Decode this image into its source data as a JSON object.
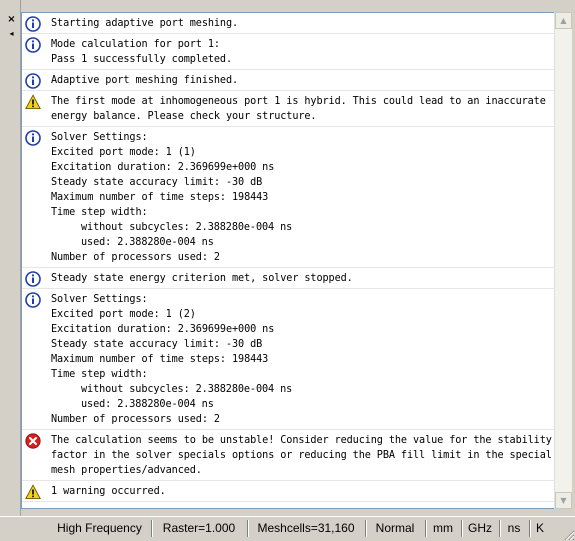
{
  "left_strip": {
    "close_glyph": "×",
    "pin_glyph": "◂"
  },
  "messages": [
    {
      "type": "info",
      "icon": "info-icon",
      "lines": [
        {
          "text": "Starting adaptive port meshing."
        }
      ]
    },
    {
      "type": "info",
      "icon": "info-icon",
      "lines": [
        {
          "text": "Mode calculation for port 1:"
        },
        {
          "text": "Pass 1 successfully completed."
        }
      ]
    },
    {
      "type": "info",
      "icon": "info-icon",
      "lines": [
        {
          "text": "Adaptive port meshing finished."
        }
      ]
    },
    {
      "type": "warning",
      "icon": "warning-icon",
      "lines": [
        {
          "text": "The first mode at inhomogeneous port 1 is hybrid. This could lead to an inaccurate"
        },
        {
          "text": "energy balance. Please check your structure."
        }
      ]
    },
    {
      "type": "info",
      "icon": "info-icon",
      "lines": [
        {
          "text": "Solver Settings:"
        },
        {
          "text": "Excited port mode: 1 (1)"
        },
        {
          "text": "Excitation duration: 2.369699e+000 ns"
        },
        {
          "text": "Steady state accuracy limit: -30 dB"
        },
        {
          "text": "Maximum number of time steps: 198443"
        },
        {
          "text": "Time step width:"
        },
        {
          "text": "without subcycles: 2.388280e-004 ns",
          "indent": true
        },
        {
          "text": "used: 2.388280e-004 ns",
          "indent": true
        },
        {
          "text": "Number of processors used: 2"
        }
      ]
    },
    {
      "type": "info",
      "icon": "info-icon",
      "lines": [
        {
          "text": "Steady state energy criterion met, solver stopped."
        }
      ]
    },
    {
      "type": "info",
      "icon": "info-icon",
      "lines": [
        {
          "text": "Solver Settings:"
        },
        {
          "text": "Excited port mode: 1 (2)"
        },
        {
          "text": "Excitation duration: 2.369699e+000 ns"
        },
        {
          "text": "Steady state accuracy limit: -30 dB"
        },
        {
          "text": "Maximum number of time steps: 198443"
        },
        {
          "text": "Time step width:"
        },
        {
          "text": "without subcycles: 2.388280e-004 ns",
          "indent": true
        },
        {
          "text": "used: 2.388280e-004 ns",
          "indent": true
        },
        {
          "text": "Number of processors used: 2"
        }
      ]
    },
    {
      "type": "error",
      "icon": "error-icon",
      "lines": [
        {
          "text": "The calculation seems to be unstable! Consider reducing the value for the stability"
        },
        {
          "text": "factor in the solver specials options or reducing the PBA fill limit in the special"
        },
        {
          "text": "mesh properties/advanced."
        }
      ]
    },
    {
      "type": "warning",
      "icon": "warning-icon",
      "lines": [
        {
          "text": "1 warning occurred."
        }
      ]
    }
  ],
  "scrollbar": {
    "up_glyph": "▲",
    "down_glyph": "▼"
  },
  "status_bar": {
    "items": [
      "High Frequency",
      "Raster=1.000",
      "Meshcells=31,160",
      "Normal",
      "mm",
      "GHz",
      "ns",
      "K"
    ]
  },
  "colors": {
    "info": "#1f3fa8",
    "warning": "#f2d21b",
    "error": "#d62020",
    "panel_bg": "#ffffff",
    "chrome": "#d4d0c8"
  }
}
